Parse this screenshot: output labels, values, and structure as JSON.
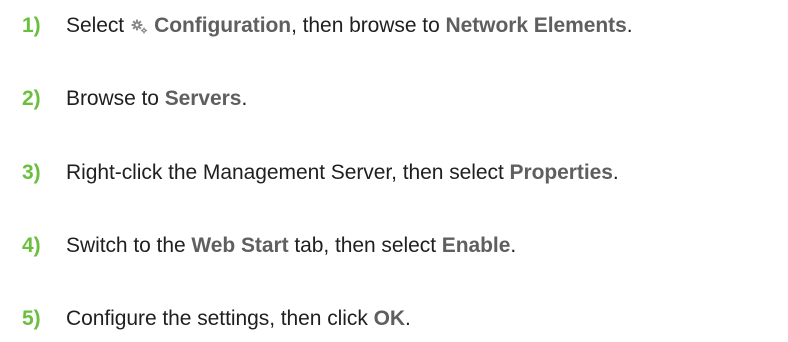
{
  "steps": [
    {
      "number": "1)",
      "parts": [
        "Select",
        "Configuration",
        ", then browse to ",
        "Network Elements",
        "."
      ],
      "icon": "gear-icon"
    },
    {
      "number": "2)",
      "parts": [
        "Browse to ",
        "Servers",
        "."
      ]
    },
    {
      "number": "3)",
      "parts": [
        "Right-click the Management Server, then select ",
        "Properties",
        "."
      ]
    },
    {
      "number": "4)",
      "parts": [
        "Switch to the ",
        "Web Start",
        " tab, then select ",
        "Enable",
        "."
      ]
    },
    {
      "number": "5)",
      "parts": [
        "Configure the settings, then click ",
        "OK",
        "."
      ]
    }
  ],
  "colors": {
    "step_number": "#6bbf3f",
    "bold_term": "#5f5f5f",
    "text": "#1f1f1f"
  }
}
